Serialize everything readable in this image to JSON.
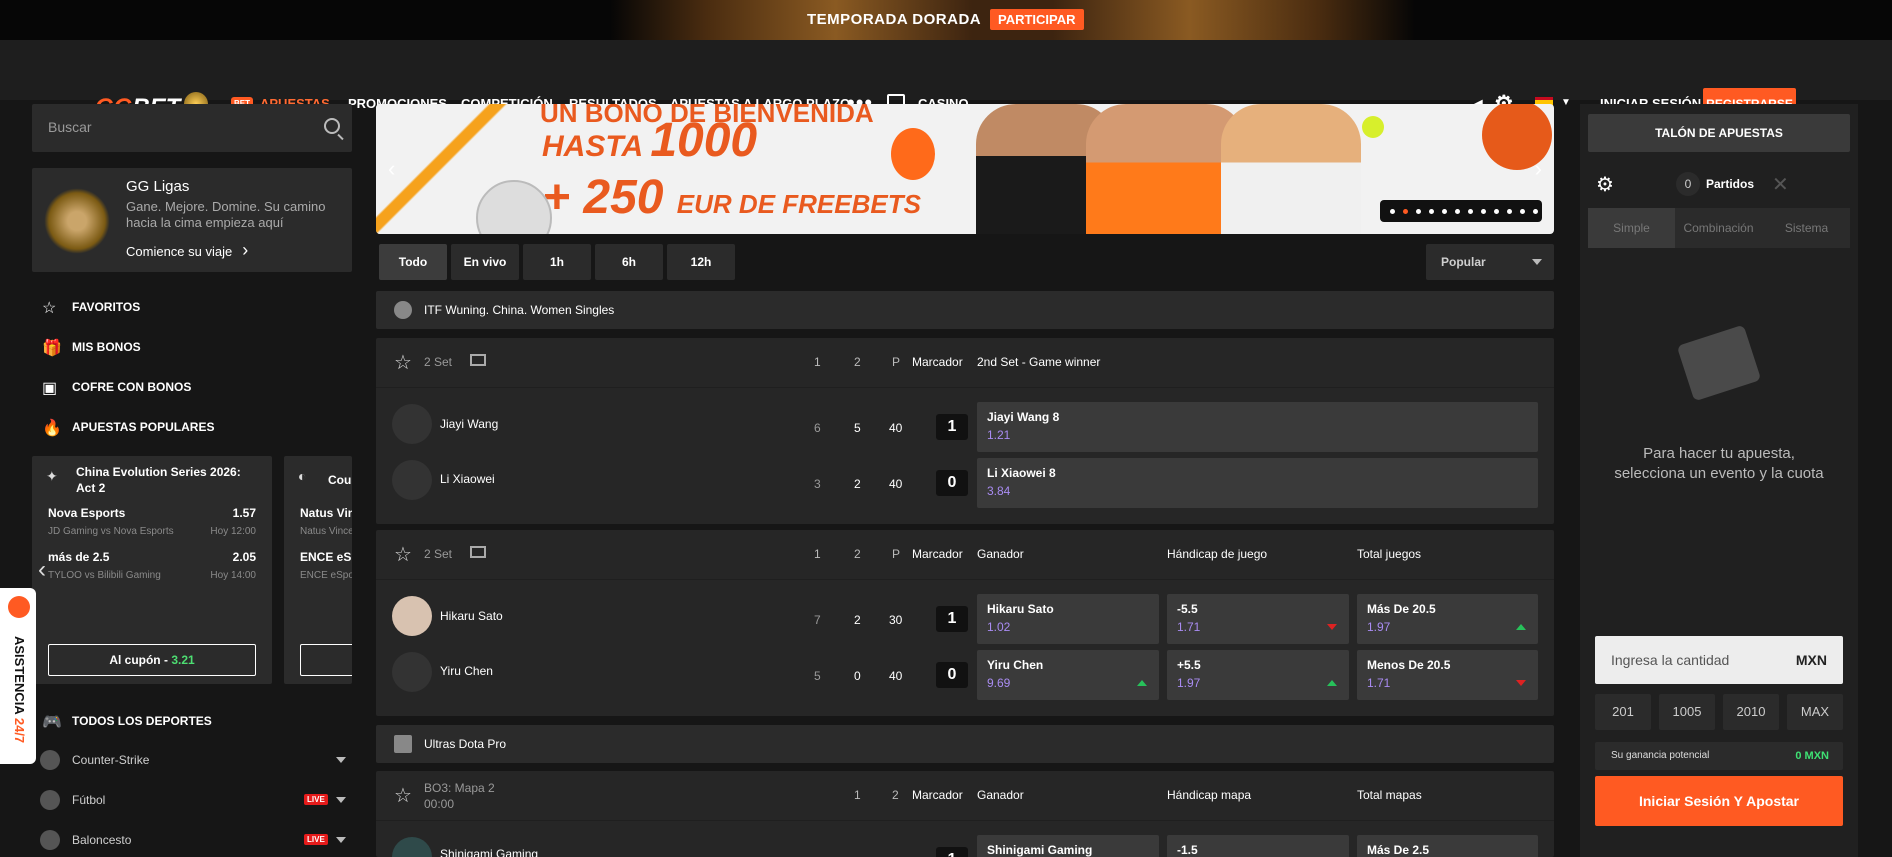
{
  "promo": {
    "text": "TEMPORADA DORADA",
    "button": "PARTICIPAR"
  },
  "nav": {
    "logo_a": "GG",
    "logo_b": "BET",
    "bet_pill": "BET",
    "items": [
      "APUESTAS",
      "PROMOCIONES",
      "COMPETICIÓN",
      "RESULTADOS",
      "APUESTAS A LARGO PLAZO",
      "CASINO"
    ],
    "more": "•••",
    "login": "INICIAR SESIÓN",
    "register": "REGISTRARSE"
  },
  "search": {
    "placeholder": "Buscar"
  },
  "league": {
    "title": "GG Ligas",
    "subtitle": "Gane. Mejore. Domine. Su camino hacia la cima empieza aquí",
    "cta": "Comience su viaje"
  },
  "sidebar": {
    "links": [
      {
        "label": "FAVORITOS",
        "icon": "star-icon"
      },
      {
        "label": "MIS BONOS",
        "icon": "gift-icon"
      },
      {
        "label": "COFRE CON BONOS",
        "icon": "chest-icon"
      },
      {
        "label": "APUESTAS POPULARES",
        "icon": "fire-icon"
      }
    ],
    "all_sports": "TODOS LOS DEPORTES",
    "sports": [
      {
        "label": "Counter-Strike",
        "live": ""
      },
      {
        "label": "Fútbol",
        "live": "LIVE"
      },
      {
        "label": "Baloncesto",
        "live": "LIVE"
      }
    ]
  },
  "popular": {
    "cards": [
      {
        "title": "China Evolution Series 2026: Act 2",
        "lines": [
          {
            "pick": "Nova Esports",
            "odd": "1.57",
            "match": "JD Gaming vs Nova Esports",
            "time": "Hoy 12:00"
          },
          {
            "pick": "más de 2.5",
            "odd": "2.05",
            "match": "TYLOO vs Bilibili Gaming",
            "time": "Hoy 14:00"
          }
        ],
        "coupon_label": "Al cupón -",
        "coupon_value": "3.21"
      },
      {
        "title": "Counter",
        "lines": [
          {
            "pick": "Natus Vin",
            "odd": "",
            "match": "Natus Vince",
            "time": ""
          },
          {
            "pick": "ENCE eSp",
            "odd": "",
            "match": "ENCE eSpo",
            "time": ""
          }
        ],
        "coupon_label": "",
        "coupon_value": ""
      }
    ]
  },
  "help": {
    "label_a": "ASISTENCIA ",
    "label_b": "24/7"
  },
  "banner": {
    "line1": "UN BONO DE BIENVENIDA",
    "line2_a": "HASTA ",
    "line2_b": "1000",
    "line3_a": "+ 250 ",
    "line3_b": "EUR DE FREEBETS",
    "slides": 12,
    "active_slide": 1
  },
  "filters": [
    "Todo",
    "En vivo",
    "1h",
    "6h",
    "12h"
  ],
  "sort": {
    "selected": "Popular"
  },
  "tournaments": [
    {
      "name": "ITF Wuning. China. Women Singles",
      "matches": [
        {
          "period": "2 Set",
          "headers": {
            "c1": "1",
            "c2": "2",
            "c3": "P",
            "c4": "Marcador",
            "market1": "2nd Set - Game winner",
            "market2": "",
            "market3": ""
          },
          "players": [
            {
              "name": "Jiayi Wang",
              "s1": "6",
              "s2": "5",
              "s3": "40",
              "score": "1"
            },
            {
              "name": "Li Xiaowei",
              "s1": "3",
              "s2": "2",
              "s3": "40",
              "score": "0"
            }
          ],
          "odds": [
            [
              {
                "label": "Jiayi Wang 8",
                "value": "1.21",
                "trend": ""
              }
            ],
            [
              {
                "label": "Li Xiaowei 8",
                "value": "3.84",
                "trend": ""
              }
            ]
          ]
        },
        {
          "period": "2 Set",
          "headers": {
            "c1": "1",
            "c2": "2",
            "c3": "P",
            "c4": "Marcador",
            "market1": "Ganador",
            "market2": "Hándicap de juego",
            "market3": "Total juegos"
          },
          "players": [
            {
              "name": "Hikaru Sato",
              "s1": "7",
              "s2": "2",
              "s3": "30",
              "score": "1"
            },
            {
              "name": "Yiru Chen",
              "s1": "5",
              "s2": "0",
              "s3": "40",
              "score": "0"
            }
          ],
          "odds": [
            [
              {
                "label": "Hikaru Sato",
                "value": "1.02",
                "trend": ""
              },
              {
                "label": "-5.5",
                "value": "1.71",
                "trend": "down"
              },
              {
                "label": "Más De 20.5",
                "value": "1.97",
                "trend": "up"
              }
            ],
            [
              {
                "label": "Yiru Chen",
                "value": "9.69",
                "trend": "up"
              },
              {
                "label": "+5.5",
                "value": "1.97",
                "trend": "up"
              },
              {
                "label": "Menos De 20.5",
                "value": "1.71",
                "trend": "down"
              }
            ]
          ]
        }
      ]
    },
    {
      "name": "Ultras Dota Pro",
      "matches": [
        {
          "period": "BO3: Mapa 2",
          "time": "00:00",
          "headers": {
            "c1": "1",
            "c2": "2",
            "c4": "Marcador",
            "market1": "Ganador",
            "market2": "Hándicap mapa",
            "market3": "Total mapas"
          },
          "players": [
            {
              "name": "Shinigami Gaming",
              "score": "1"
            }
          ],
          "odds": [
            [
              {
                "label": "Shinigami Gaming",
                "value": ""
              },
              {
                "label": "-1.5",
                "value": ""
              },
              {
                "label": "Más De 2.5",
                "value": ""
              }
            ]
          ]
        }
      ]
    }
  ],
  "slip": {
    "title": "TALÓN DE APUESTAS",
    "count": "0",
    "count_label": "Partidos",
    "tabs": [
      "Simple",
      "Combinación",
      "Sistema"
    ],
    "empty": "Para hacer tu apuesta, selecciona un evento y la cuota",
    "amount_placeholder": "Ingresa la cantidad",
    "currency": "MXN",
    "quick": [
      "201",
      "1005",
      "2010",
      "MAX"
    ],
    "potential_label": "Su ganancia potencial",
    "potential_value": "0 MXN",
    "cta": "Iniciar Sesión Y Apostar"
  },
  "colors": {
    "accent": "#ff5a22",
    "odds_value": "#a98cf2",
    "up": "#27c15a",
    "down": "#d22222",
    "win": "#3ee073"
  }
}
